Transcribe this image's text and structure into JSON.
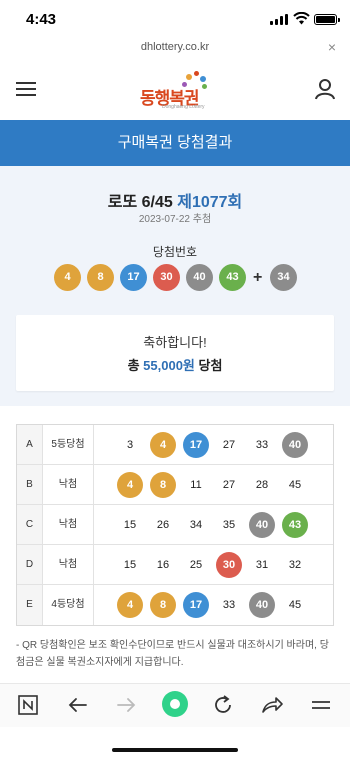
{
  "status_bar": {
    "time": "4:43"
  },
  "url_bar": {
    "url": "dhlottery.co.kr",
    "close_label": "×"
  },
  "header": {
    "logo_text": "동행복권",
    "logo_sub": "Donghaeng Lottery"
  },
  "banner": {
    "title": "구매복권 당첨결과"
  },
  "result": {
    "game": "로또 6/45",
    "round": "제1077회",
    "date": "2023-07-22 추첨",
    "winning_label": "당첨번호",
    "winning_numbers": [
      4,
      8,
      17,
      30,
      40,
      43
    ],
    "plus": "+",
    "bonus_number": 34,
    "congrats": "축하합니다!",
    "prize_prefix": "총",
    "prize_amount": "55,000원",
    "prize_suffix": "당첨"
  },
  "ball_colors": {
    "yellow": "#dfa33b",
    "blue": "#3f8fd4",
    "red": "#dc5c4f",
    "gray": "#8c8c8c",
    "green": "#6ab04c"
  },
  "tickets": [
    {
      "line": "A",
      "rank": "5등당첨",
      "numbers": [
        "3",
        "4",
        "17",
        "27",
        "33",
        "40"
      ],
      "hits": [
        false,
        true,
        true,
        false,
        false,
        true
      ]
    },
    {
      "line": "B",
      "rank": "낙첨",
      "numbers": [
        "4",
        "8",
        "11",
        "27",
        "28",
        "45"
      ],
      "hits": [
        true,
        true,
        false,
        false,
        false,
        false
      ]
    },
    {
      "line": "C",
      "rank": "낙첨",
      "numbers": [
        "15",
        "26",
        "34",
        "35",
        "40",
        "43"
      ],
      "hits": [
        false,
        false,
        false,
        false,
        true,
        true
      ]
    },
    {
      "line": "D",
      "rank": "낙첨",
      "numbers": [
        "15",
        "16",
        "25",
        "30",
        "31",
        "32"
      ],
      "hits": [
        false,
        false,
        false,
        true,
        false,
        false
      ]
    },
    {
      "line": "E",
      "rank": "4등당첨",
      "numbers": [
        "4",
        "8",
        "17",
        "33",
        "40",
        "45"
      ],
      "hits": [
        true,
        true,
        true,
        false,
        true,
        false
      ]
    }
  ],
  "note": "- QR 당첨확인은 보조 확인수단이므로 반드시 실물과 대조하시기 바라며, 당첨금은 실물 복권소지자에게 지급합니다.",
  "toolbar": {
    "icons": [
      "naver-home-icon",
      "back-arrow-icon",
      "forward-arrow-icon",
      "green-dot-icon",
      "reload-icon",
      "share-icon",
      "menu-icon"
    ]
  }
}
